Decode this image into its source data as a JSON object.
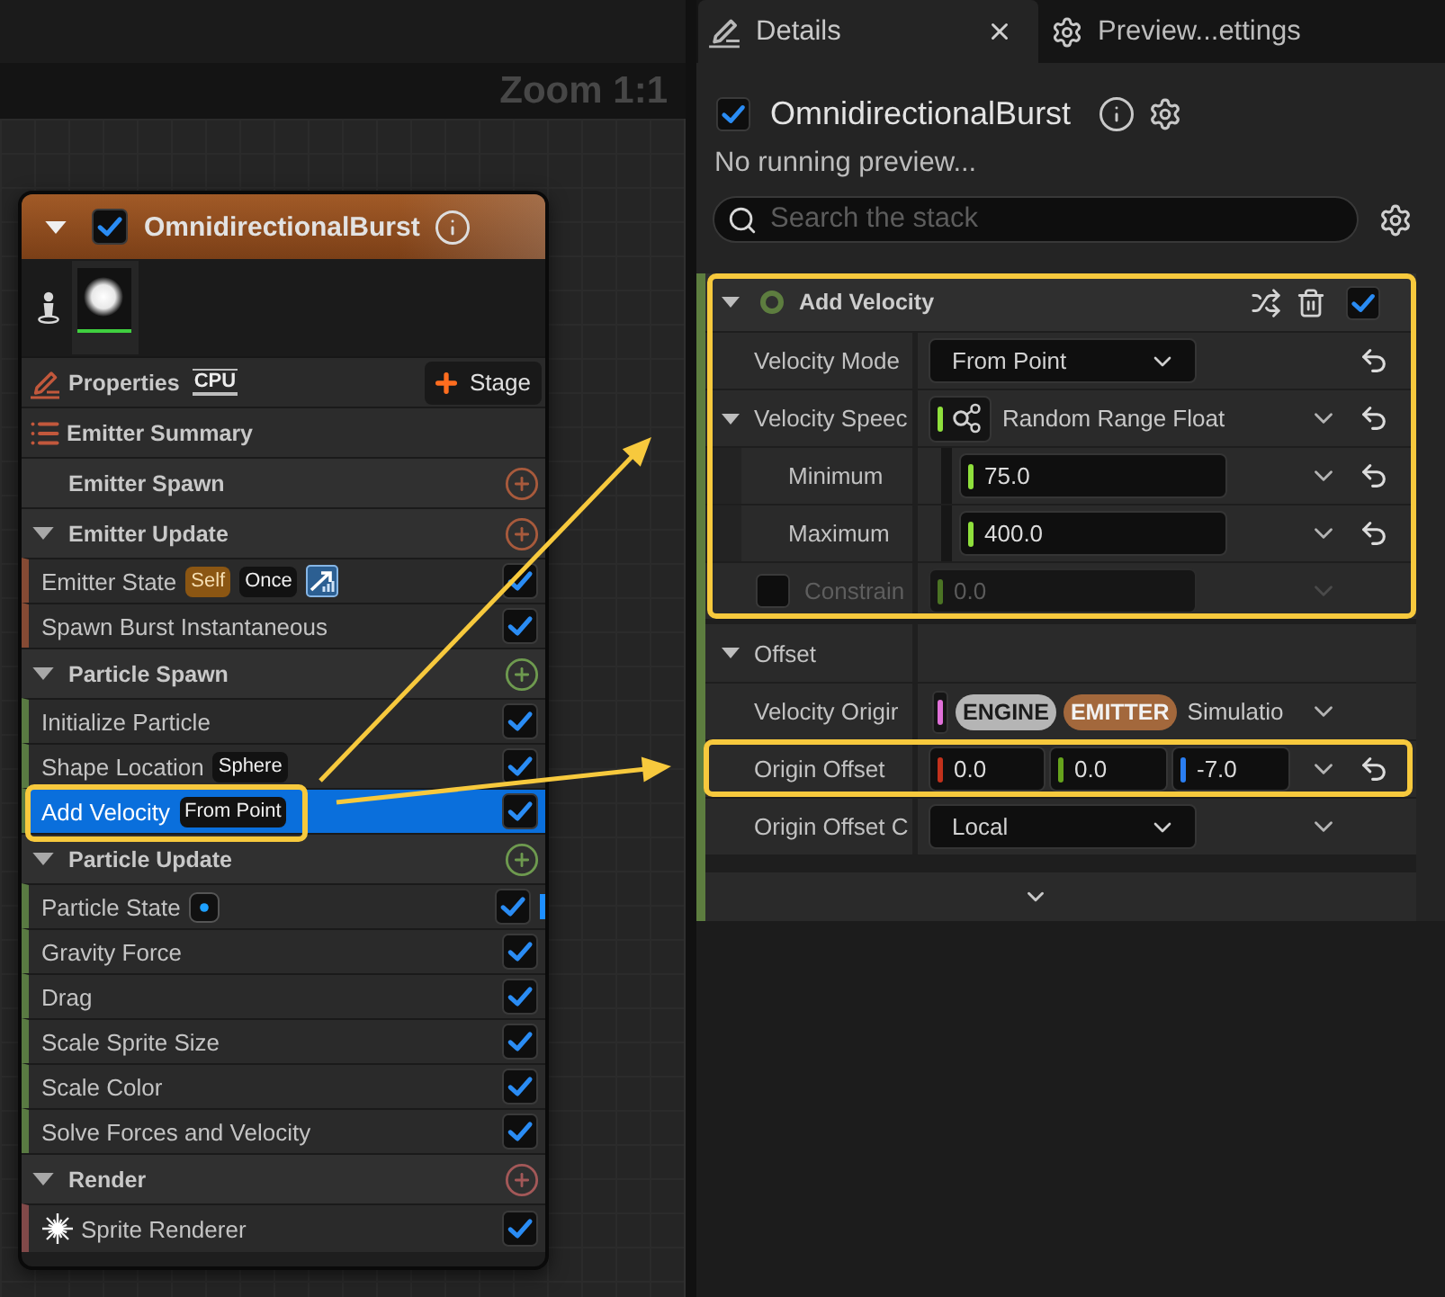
{
  "canvas": {
    "zoom_label": "Zoom 1:1"
  },
  "emitter_node": {
    "title": "OmnidirectionalBurst",
    "expanded": true,
    "enabled": true,
    "properties_label": "Properties",
    "sim_target": "CPU",
    "add_stage_label": "Stage",
    "sections": [
      {
        "kind": "summary",
        "label": "Emitter Summary"
      },
      {
        "kind": "stage",
        "label": "Emitter Spawn",
        "color": "#a85a3c"
      },
      {
        "kind": "stage",
        "label": "Emitter Update",
        "color": "#a85a3c",
        "expanded": true,
        "modules": [
          {
            "kind": "module",
            "label": "Emitter State",
            "enabled": true,
            "selected": false,
            "highlighted": false,
            "marker": false,
            "tags": [
              {
                "kind": "accent",
                "label": "Self"
              },
              {
                "kind": "plain",
                "label": "Once"
              },
              {
                "kind": "chart"
              }
            ]
          },
          {
            "kind": "module",
            "label": "Spawn Burst Instantaneous",
            "enabled": true,
            "selected": false,
            "highlighted": false,
            "marker": false
          }
        ]
      },
      {
        "kind": "stage",
        "label": "Particle Spawn",
        "color": "#6e9a4f",
        "expanded": true,
        "modules": [
          {
            "kind": "module",
            "label": "Initialize Particle",
            "enabled": true,
            "selected": false,
            "highlighted": false,
            "marker": false
          },
          {
            "kind": "module",
            "label": "Shape Location",
            "enabled": true,
            "selected": false,
            "highlighted": false,
            "marker": false,
            "tags": [
              {
                "kind": "plain",
                "label": "Sphere"
              }
            ]
          },
          {
            "kind": "module",
            "label": "Add Velocity",
            "enabled": true,
            "selected": true,
            "highlighted": true,
            "marker": false,
            "tags": [
              {
                "kind": "plain",
                "label": "From Point"
              }
            ]
          }
        ]
      },
      {
        "kind": "stage",
        "label": "Particle Update",
        "color": "#6e9a4f",
        "expanded": true,
        "modules": [
          {
            "kind": "module",
            "label": "Particle State",
            "enabled": true,
            "selected": false,
            "highlighted": false,
            "marker": true,
            "tags": [
              {
                "kind": "dot"
              }
            ]
          },
          {
            "kind": "module",
            "label": "Gravity Force",
            "enabled": true,
            "selected": false,
            "highlighted": false,
            "marker": false
          },
          {
            "kind": "module",
            "label": "Drag",
            "enabled": true,
            "selected": false,
            "highlighted": false,
            "marker": false
          },
          {
            "kind": "module",
            "label": "Scale Sprite Size",
            "enabled": true,
            "selected": false,
            "highlighted": false,
            "marker": false
          },
          {
            "kind": "module",
            "label": "Scale Color",
            "enabled": true,
            "selected": false,
            "highlighted": false,
            "marker": false
          },
          {
            "kind": "module",
            "label": "Solve Forces and Velocity",
            "enabled": true,
            "selected": false,
            "highlighted": false,
            "marker": false
          }
        ]
      },
      {
        "kind": "stage",
        "label": "Render",
        "color": "#a35858",
        "expanded": true,
        "modules": [
          {
            "kind": "renderer",
            "label": "Sprite Renderer",
            "enabled": true,
            "selected": false,
            "highlighted": false,
            "marker": false
          }
        ]
      }
    ]
  },
  "details_panel": {
    "tabs": [
      {
        "kind": "details",
        "label": "Details",
        "selected": true,
        "closable": true
      },
      {
        "kind": "settings",
        "label": "Preview...ettings",
        "selected": false,
        "closable": false
      }
    ],
    "emitter": {
      "name": "OmnidirectionalBurst",
      "enabled": true
    },
    "status": "No running preview...",
    "search": {
      "placeholder": "Search the stack"
    },
    "module": {
      "title": "Add Velocity",
      "color": "#5d7d3f",
      "expanded": true,
      "enabled": true,
      "highlighted": true,
      "properties": [
        {
          "kind": "dropdown",
          "label": "Velocity Mode",
          "value": "From Point",
          "disabled": false,
          "options_menu": false,
          "resettable": true,
          "highlighted": false
        },
        {
          "kind": "dynamic",
          "label": "Velocity Speec",
          "value": "Random Range Float",
          "color": "#8fe03c",
          "expanded": true,
          "disabled": false,
          "options_menu": true,
          "resettable": true,
          "highlighted": false,
          "children": [
            {
              "kind": "number",
              "label": "Minimum",
              "value": "75.0",
              "color": "#8fe03c",
              "disabled": false,
              "options_menu": true,
              "resettable": true,
              "highlighted": false
            },
            {
              "kind": "number",
              "label": "Maximum",
              "value": "400.0",
              "color": "#8fe03c",
              "disabled": false,
              "options_menu": true,
              "resettable": true,
              "highlighted": false
            }
          ]
        },
        {
          "kind": "number",
          "label": "Constrain",
          "value": "0.0",
          "color": "#4b7424",
          "checked": false,
          "disabled": true,
          "options_menu": true,
          "resettable": false,
          "highlighted": false
        }
      ]
    },
    "sections": [
      {
        "label": "Offset",
        "expanded": true,
        "properties": [
          {
            "kind": "linked",
            "label": "Velocity Origir",
            "color": "#e070d8",
            "badges": [
              {
                "kind": "neutral",
                "label": "ENGINE"
              },
              {
                "kind": "accent",
                "label": "EMITTER"
              }
            ],
            "value": "Simulatio",
            "disabled": false,
            "options_menu": true,
            "resettable": false,
            "highlighted": false
          },
          {
            "kind": "vector",
            "label": "Origin Offset",
            "components": [
              {
                "value": "0.0",
                "color": "#c2311c"
              },
              {
                "value": "0.0",
                "color": "#66a31c"
              },
              {
                "value": "-7.0",
                "color": "#2a7ef2"
              }
            ],
            "disabled": false,
            "options_menu": true,
            "resettable": true,
            "highlighted": true
          },
          {
            "kind": "dropdown",
            "label": "Origin Offset C",
            "value": "Local",
            "disabled": false,
            "options_menu": true,
            "resettable": false,
            "highlighted": false
          }
        ]
      }
    ]
  }
}
